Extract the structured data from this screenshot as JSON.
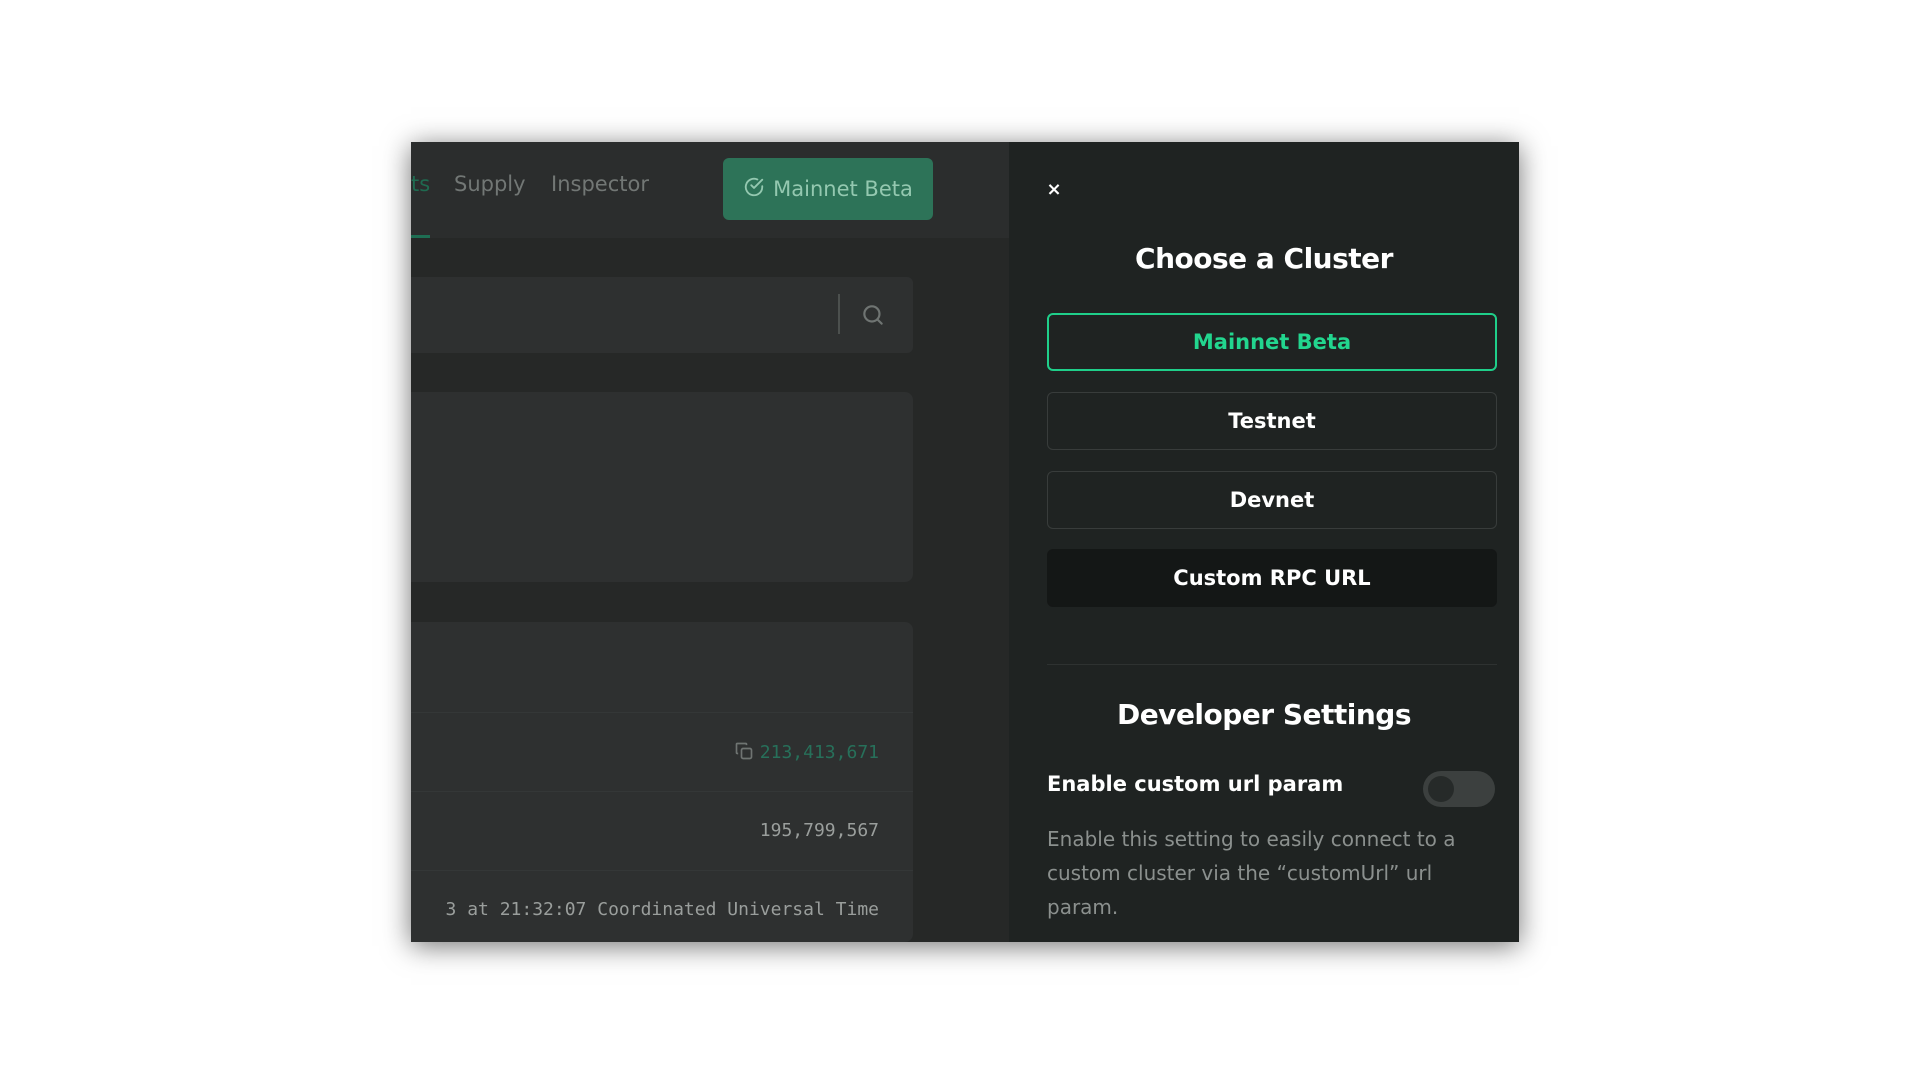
{
  "nav": {
    "items": [
      {
        "label": "ts"
      },
      {
        "label": "Supply"
      },
      {
        "label": "Inspector"
      }
    ],
    "cluster_button": {
      "label": "Mainnet Beta"
    }
  },
  "rows": [
    {
      "value": "213,413,671"
    },
    {
      "value": "195,799,567"
    },
    {
      "value": "3 at 21:32:07 Coordinated Universal Time"
    }
  ],
  "cluster_panel": {
    "close_label": "×",
    "title": "Choose a Cluster",
    "clusters": [
      {
        "label": "Mainnet Beta",
        "selected": true
      },
      {
        "label": "Testnet",
        "selected": false
      },
      {
        "label": "Devnet",
        "selected": false
      },
      {
        "label": "Custom RPC URL",
        "selected": false
      }
    ],
    "dev_title": "Developer Settings",
    "setting": {
      "label": "Enable custom url param",
      "enabled": false,
      "description": "Enable this setting to easily connect to a custom cluster via the “customUrl” url param."
    }
  },
  "colors": {
    "accent": "#1fcf8a",
    "panel_bg": "#1f2322",
    "page_bg": "#262827"
  }
}
